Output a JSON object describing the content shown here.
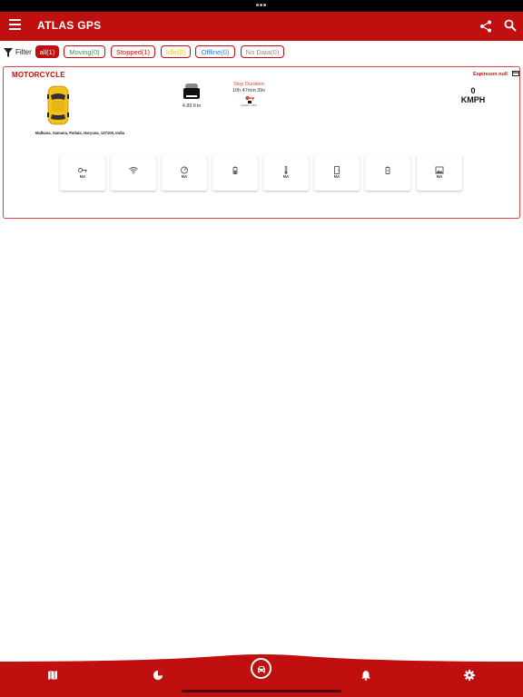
{
  "app": {
    "title": "ATLAS GPS"
  },
  "filters": {
    "label": "Filter",
    "chips": [
      {
        "label": "all(1)",
        "active": true,
        "color": "#ffffff"
      },
      {
        "label": "Moving(0)",
        "color": "#2e9e3e"
      },
      {
        "label": "Stopped(1)",
        "color": "#c00f0f"
      },
      {
        "label": "Idle(0)",
        "color": "#e6c700"
      },
      {
        "label": "Offline(0)",
        "color": "#2a7fd4"
      },
      {
        "label": "No Data(0)",
        "color": "#8a8a8a"
      }
    ]
  },
  "vehicle": {
    "name": "MOTORCYCLE",
    "address": "Malkana, Samana, Patiala, Haryana, 147100, India",
    "odometer": "4.89 Km",
    "stop_title": "Stop Duration",
    "stop_duration": "10h 47min 39s",
    "stop_small": "Ignition: OFF",
    "expiry": "Expireson null",
    "speed_value": "0",
    "speed_unit": "KMPH"
  },
  "sensors": [
    {
      "icon": "key-icon",
      "value": "NA"
    },
    {
      "icon": "wifi-icon",
      "value": ""
    },
    {
      "icon": "gauge-icon",
      "value": "NA"
    },
    {
      "icon": "battery-icon",
      "value": ""
    },
    {
      "icon": "thermometer-icon",
      "value": "NA"
    },
    {
      "icon": "door-icon",
      "value": "NA"
    },
    {
      "icon": "power-icon",
      "value": ""
    },
    {
      "icon": "image-icon",
      "value": "NA"
    }
  ],
  "bottom_nav": [
    "map-icon",
    "pie-chart-icon",
    "car-icon",
    "bell-icon",
    "gear-icon"
  ],
  "colors": {
    "brand": "#c00f0f",
    "card_border": "#d94848"
  }
}
